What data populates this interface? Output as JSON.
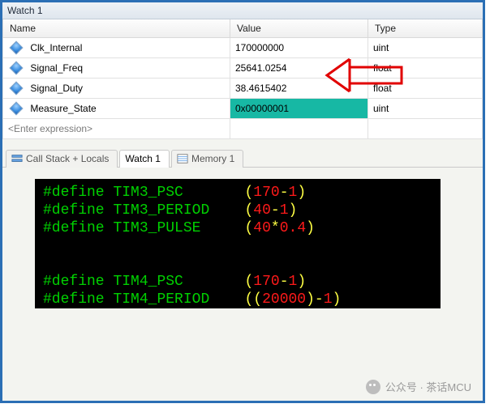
{
  "window": {
    "title": "Watch 1"
  },
  "table": {
    "headers": {
      "name": "Name",
      "value": "Value",
      "type": "Type"
    },
    "rows": [
      {
        "name": "Clk_Internal",
        "value": "170000000",
        "type": "uint",
        "hl": false
      },
      {
        "name": "Signal_Freq",
        "value": "25641.0254",
        "type": "float",
        "hl": false
      },
      {
        "name": "Signal_Duty",
        "value": "38.4615402",
        "type": "float",
        "hl": false
      },
      {
        "name": "Measure_State",
        "value": "0x00000001",
        "type": "uint",
        "hl": true
      }
    ],
    "enter_expression": "<Enter expression>"
  },
  "tabs": {
    "callstack": "Call Stack + Locals",
    "watch1": "Watch 1",
    "memory1": "Memory 1"
  },
  "code": {
    "l1_kw": "#define",
    "l1_id": "TIM3_PSC",
    "l1_n1": "170",
    "l1_op": "-",
    "l1_n2": "1",
    "l2_kw": "#define",
    "l2_id": "TIM3_PERIOD",
    "l2_n1": "40",
    "l2_op": "-",
    "l2_n2": "1",
    "l3_kw": "#define",
    "l3_id": "TIM3_PULSE",
    "l3_n1": "40",
    "l3_op": "*",
    "l3_n2": "0.4",
    "l4_kw": "#define",
    "l4_id": "TIM4_PSC",
    "l4_n1": "170",
    "l4_op": "-",
    "l4_n2": "1",
    "l5_kw": "#define",
    "l5_id": "TIM4_PERIOD",
    "l5_n1": "20000",
    "l5_op": "-",
    "l5_n2": "1"
  },
  "footer": {
    "text": "公众号 · 茶话MCU"
  }
}
